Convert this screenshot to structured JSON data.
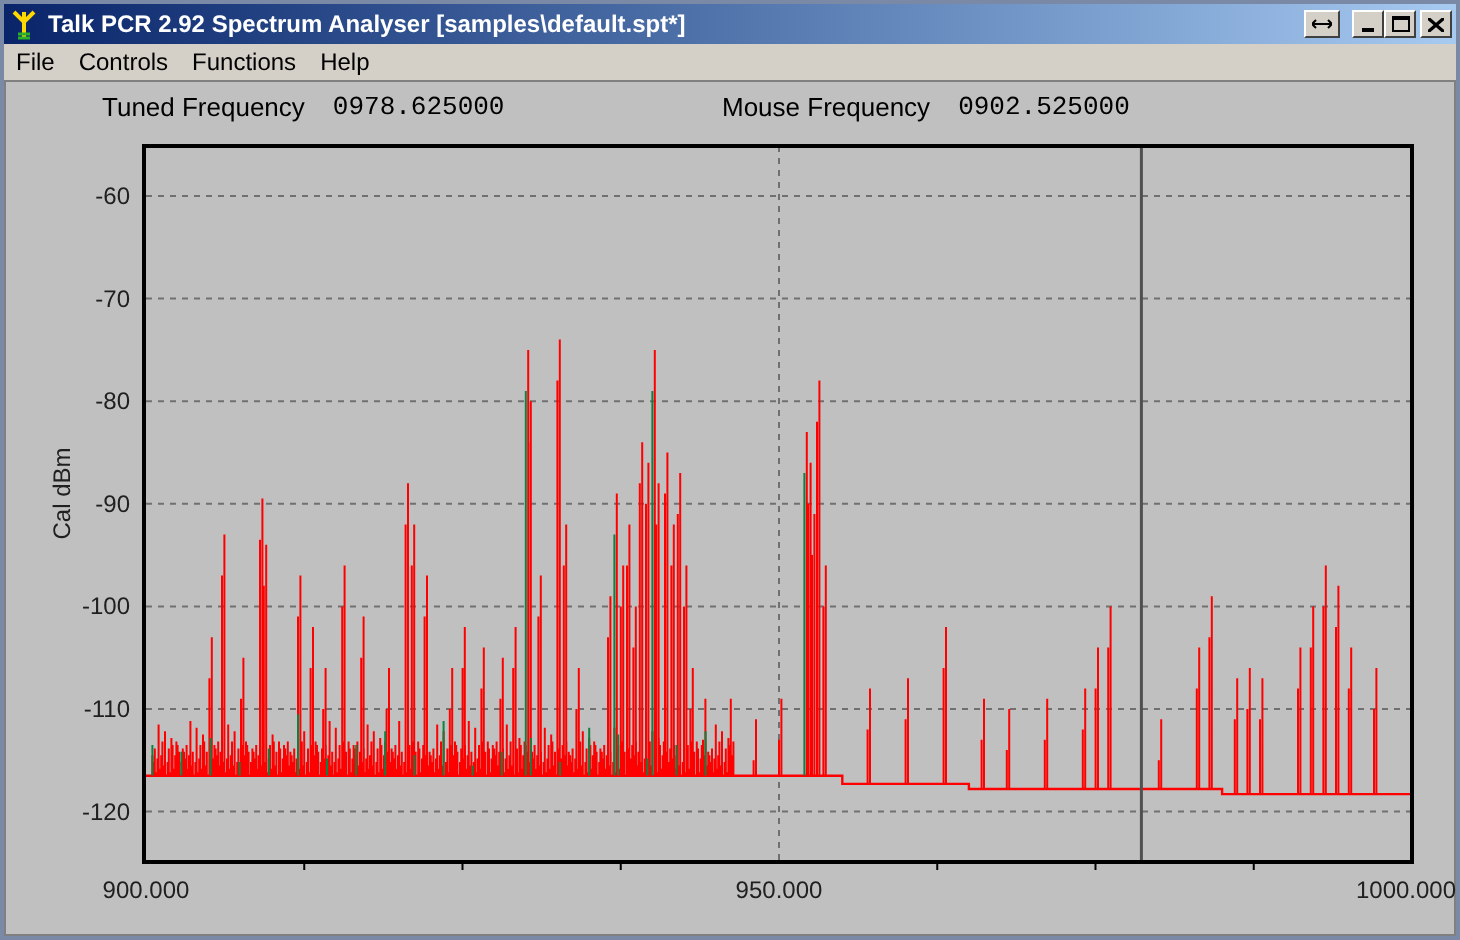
{
  "window": {
    "title": "Talk PCR 2.92 Spectrum Analyser [samples\\default.spt*]"
  },
  "menu": [
    "File",
    "Controls",
    "Functions",
    "Help"
  ],
  "readouts": [
    {
      "label": "Tuned Frequency",
      "value": "0978.625000"
    },
    {
      "label": "Mouse Frequency",
      "value": "0902.525000"
    }
  ],
  "plot": {
    "ylabel": "Cal dBm",
    "yticks": [
      "-60",
      "-70",
      "-80",
      "-90",
      "-100",
      "-110",
      "-120"
    ],
    "xticks": [
      "900.000",
      "950.000",
      "1000.000"
    ]
  }
}
